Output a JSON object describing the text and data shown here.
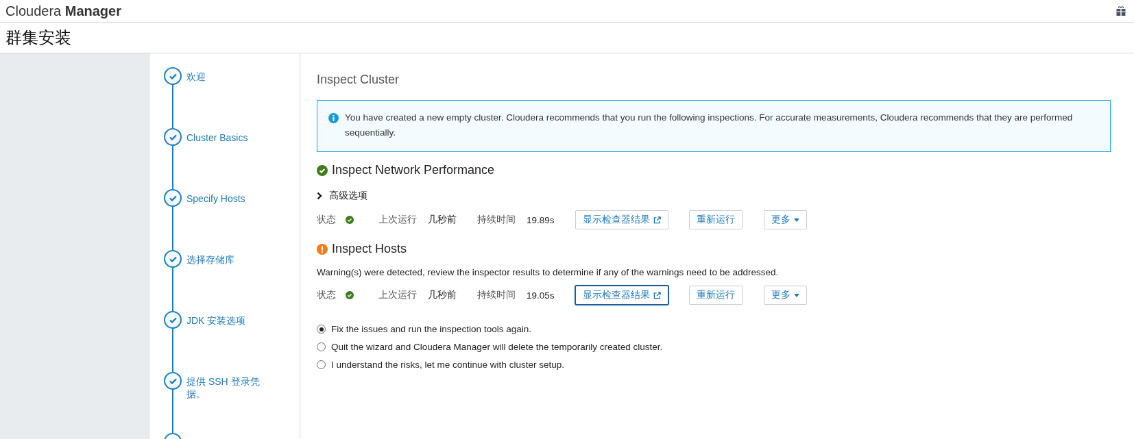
{
  "topbar": {
    "brand_light": "Cloudera",
    "brand_bold": "Manager"
  },
  "page_title": "群集安装",
  "steps": [
    {
      "label": "欢迎",
      "done": true
    },
    {
      "label": "Cluster Basics",
      "done": true
    },
    {
      "label": "Specify Hosts",
      "done": true
    },
    {
      "label": "选择存储库",
      "done": true
    },
    {
      "label": "JDK 安装选项",
      "done": true
    },
    {
      "label": "提供 SSH 登录凭据。",
      "done": true
    }
  ],
  "main": {
    "title": "Inspect Cluster",
    "info": "You have created a new empty cluster. Cloudera recommends that you run the following inspections. For accurate measurements, Cloudera recommends that they are performed sequentially.",
    "sections": [
      {
        "title": "Inspect Network Performance",
        "warning": false,
        "advanced": "高级选项",
        "status_label": "状态",
        "status_ok": true,
        "last_run_label": "上次运行",
        "last_run": "几秒前",
        "duration_label": "持续时间",
        "duration": "19.89s",
        "buttons": [
          {
            "label": "显示检查器结果",
            "kind": "external",
            "focused": false
          },
          {
            "label": "重新运行",
            "kind": "plain",
            "focused": false
          },
          {
            "label": "更多",
            "kind": "dropdown",
            "focused": false
          }
        ]
      },
      {
        "title": "Inspect Hosts",
        "warning": true,
        "message": "Warning(s) were detected, review the inspector results to determine if any of the warnings need to be addressed.",
        "status_label": "状态",
        "status_ok": true,
        "last_run_label": "上次运行",
        "last_run": "几秒前",
        "duration_label": "持续时间",
        "duration": "19.05s",
        "buttons": [
          {
            "label": "显示检查器结果",
            "kind": "external",
            "focused": true
          },
          {
            "label": "重新运行",
            "kind": "plain",
            "focused": false
          },
          {
            "label": "更多",
            "kind": "dropdown",
            "focused": false
          }
        ]
      }
    ],
    "options": [
      {
        "label": "Fix the issues and run the inspection tools again.",
        "selected": true
      },
      {
        "label": "Quit the wizard and Cloudera Manager will delete the temporarily created cluster.",
        "selected": false
      },
      {
        "label": "I understand the risks, let me continue with cluster setup.",
        "selected": false
      }
    ]
  }
}
